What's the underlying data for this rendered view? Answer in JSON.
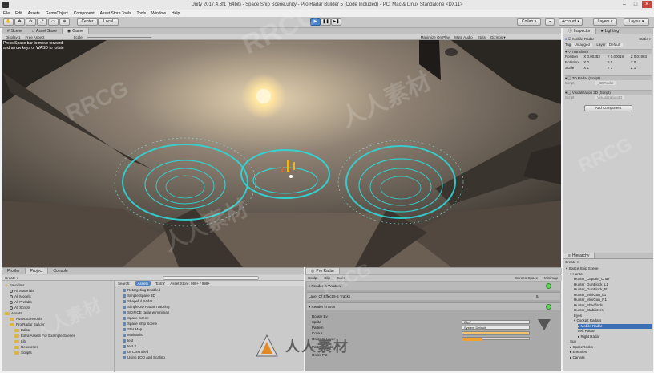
{
  "window": {
    "title": "Unity 2017.4.3f1 (64bit) - Space Ship Scene.unity - Pro Radar Builder 5 (Code Included) - PC, Mac & Linux Standalone <DX11>"
  },
  "menu": [
    "File",
    "Edit",
    "Assets",
    "GameObject",
    "Component",
    "Asset Store Tools",
    "Tools",
    "Window",
    "Help"
  ],
  "toolbar": {
    "center_label": "Center",
    "local_label": "Local",
    "collab_label": "Collab ▾",
    "account_label": "Account ▾",
    "layers_label": "Layers ▾",
    "layout_label": "Layout ▾"
  },
  "scene_tabs": [
    "Scene",
    "Asset Store",
    "Game"
  ],
  "scene_bar": {
    "display": "Display 1",
    "aspect": "Free Aspect",
    "scale": "Scale",
    "maximize": "Maximize On Play",
    "mute": "Mute Audio",
    "stats": "Stats",
    "gizmos": "Gizmos ▾"
  },
  "help_text": "Press Space bar to move forward and arrow keys or WASD to rotate",
  "inspector": {
    "tabs": [
      "Inspector",
      "Lighting"
    ],
    "object_name": "Mobile Radar",
    "static_label": "Static ▾",
    "tag_label": "Tag",
    "tag_value": "Untagged",
    "layer_label": "Layer",
    "layer_value": "Default",
    "transform_label": "Transform",
    "position_label": "Position",
    "position": [
      "X 0.00383",
      "Y 0.00019",
      "Z 0.01983"
    ],
    "rotation_label": "Rotation",
    "rotation": [
      "X 0",
      "Y 0",
      "Z 0"
    ],
    "scale_label": "Scale",
    "scale": [
      "X 1",
      "Y 1",
      "Z 1"
    ],
    "comp1": "3D Radar (Script)",
    "comp1_field": "Script",
    "comp1_value": "_3DRadar",
    "comp2": "Visualization 3D (Script)",
    "comp2_field": "Script",
    "comp2_value": "Visualization3D",
    "add_component": "Add Component"
  },
  "hierarchy": {
    "tab": "Hierarchy",
    "create": "Create ▾",
    "items": [
      {
        "label": "▾ Space Ship Scene",
        "indent": 0,
        "selected": false
      },
      {
        "label": "▾ Hunter",
        "indent": 1,
        "selected": false
      },
      {
        "label": "Hunter_Captain_Chair",
        "indent": 2,
        "selected": false
      },
      {
        "label": "Hunter_GunBlock_L1",
        "indent": 2,
        "selected": false
      },
      {
        "label": "Hunter_GunBlock_R1",
        "indent": 2,
        "selected": false
      },
      {
        "label": "Hunter_MiniGun_L1",
        "indent": 2,
        "selected": false
      },
      {
        "label": "Hunter_MiniGun_R1",
        "indent": 2,
        "selected": false
      },
      {
        "label": "Hunter_Shadfinds",
        "indent": 2,
        "selected": false
      },
      {
        "label": "Hunter_Stabilizers",
        "indent": 2,
        "selected": false
      },
      {
        "label": "Eyes",
        "indent": 2,
        "selected": false
      },
      {
        "label": "▾ Cockpit Radars",
        "indent": 2,
        "selected": false
      },
      {
        "label": "▸ Mobile Radar",
        "indent": 3,
        "selected": true
      },
      {
        "label": "Left Radar",
        "indent": 3,
        "selected": false
      },
      {
        "label": "▸ Right Radar",
        "indent": 3,
        "selected": false
      },
      {
        "label": "Sun",
        "indent": 1,
        "selected": false
      },
      {
        "label": "▸ SpaceRocks",
        "indent": 1,
        "selected": false
      },
      {
        "label": "▸ Enemies",
        "indent": 1,
        "selected": false
      },
      {
        "label": "▸ Canvas",
        "indent": 1,
        "selected": false
      }
    ]
  },
  "project": {
    "tabs": [
      "Profiler",
      "Project",
      "Console"
    ],
    "create": "Create ▾",
    "tree": [
      {
        "label": "Favorites",
        "indent": 0,
        "icon": "star"
      },
      {
        "label": "All Materials",
        "indent": 1,
        "icon": "search"
      },
      {
        "label": "All Models",
        "indent": 1,
        "icon": "search"
      },
      {
        "label": "All Prefabs",
        "indent": 1,
        "icon": "search"
      },
      {
        "label": "All Scripts",
        "indent": 1,
        "icon": "search"
      },
      {
        "label": "Assets",
        "indent": 0,
        "icon": "folder"
      },
      {
        "label": "AssetStoreTools",
        "indent": 1,
        "icon": "folder"
      },
      {
        "label": "Pro Radar Builder",
        "indent": 1,
        "icon": "folder"
      },
      {
        "label": "Editor",
        "indent": 2,
        "icon": "folder"
      },
      {
        "label": "Extra Assets For Example Scenes",
        "indent": 2,
        "icon": "folder"
      },
      {
        "label": "Lib",
        "indent": 2,
        "icon": "folder"
      },
      {
        "label": "Resources",
        "indent": 2,
        "icon": "folder"
      },
      {
        "label": "Scripts",
        "indent": 2,
        "icon": "folder"
      }
    ],
    "search_label": "Search:",
    "search_assets": "Assets",
    "search_folder": "'Extra'",
    "search_store": "Asset Store: 999+ / 999+",
    "assets": [
      "Retargeting Enabled",
      "Simple Space 3D",
      "Shapeful Radar",
      "Simple 3D Radar Tracking",
      "SCIFICE radar w minimap",
      "Space Scene",
      "Space Ship Scene",
      "Star Map",
      "Minimalist",
      "test",
      "test 2",
      "UI Controlled",
      "Using LOD and Scaling"
    ]
  },
  "radar_panel": {
    "tab": "Pro Radar",
    "toolbar": [
      "Sculpt",
      "Blip",
      "Tools"
    ],
    "screen_space": "Screen Space",
    "minimap": "Minimap",
    "rows": [
      "▾ Render in Window",
      "Layer Of Effect 5-6 Tracks",
      "▾ Render in Arcs",
      "Rotate By",
      "Sprite",
      "Pattern",
      "Colour",
      "Order In Layer",
      "Pattern Mode",
      "Order Pat"
    ],
    "layer_value": "5",
    "blip_field": "Blip7",
    "sprite_field": "System Default",
    "fill_fraction": 0.3
  },
  "watermarks": [
    "RRCG",
    "人人素材"
  ],
  "logo_text": "人人素材"
}
